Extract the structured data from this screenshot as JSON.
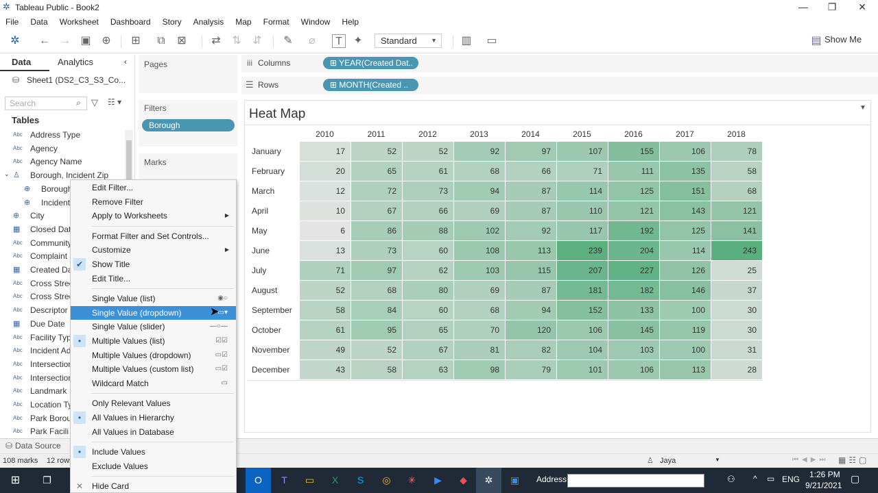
{
  "window": {
    "title": "Tableau Public - Book2",
    "minimize": "—",
    "restore": "❐",
    "close": "✕"
  },
  "menu": [
    "File",
    "Data",
    "Worksheet",
    "Dashboard",
    "Story",
    "Analysis",
    "Map",
    "Format",
    "Window",
    "Help"
  ],
  "toolbar": {
    "view_select": "Standard",
    "show_me": "Show Me"
  },
  "datapane": {
    "tab_data": "Data",
    "tab_analytics": "Analytics",
    "datasource": "Sheet1 (DS2_C3_S3_Co...",
    "search_placeholder": "Search",
    "tables_header": "Tables",
    "fields": [
      {
        "type": "Abc",
        "label": "Address Type"
      },
      {
        "type": "Abc",
        "label": "Agency"
      },
      {
        "type": "Abc",
        "label": "Agency Name"
      },
      {
        "type": "hier",
        "label": "Borough, Incident Zip"
      },
      {
        "type": "geo",
        "label": "Borough"
      },
      {
        "type": "geo",
        "label": "Incident"
      },
      {
        "type": "geo",
        "label": "City"
      },
      {
        "type": "date",
        "label": "Closed Dat"
      },
      {
        "type": "Abc",
        "label": "Community"
      },
      {
        "type": "Abc",
        "label": "Complaint"
      },
      {
        "type": "date",
        "label": "Created Da"
      },
      {
        "type": "Abc",
        "label": "Cross Stree"
      },
      {
        "type": "Abc",
        "label": "Cross Stree"
      },
      {
        "type": "Abc",
        "label": "Descriptor"
      },
      {
        "type": "date",
        "label": "Due Date"
      },
      {
        "type": "Abc",
        "label": "Facility Typ"
      },
      {
        "type": "Abc",
        "label": "Incident Ad"
      },
      {
        "type": "Abc",
        "label": "Intersection"
      },
      {
        "type": "Abc",
        "label": "Intersection"
      },
      {
        "type": "Abc",
        "label": "Landmark"
      },
      {
        "type": "Abc",
        "label": "Location Ty"
      },
      {
        "type": "Abc",
        "label": "Park Borou"
      },
      {
        "type": "Abc",
        "label": "Park Facili"
      }
    ]
  },
  "cards": {
    "pages": "Pages",
    "filters": "Filters",
    "filter_pill": "Borough",
    "marks": "Marks"
  },
  "shelves": {
    "columns_label": "Columns",
    "columns_pill": "YEAR(Created Dat..",
    "rows_label": "Rows",
    "rows_pill": "MONTH(Created .."
  },
  "view": {
    "title": "Heat Map"
  },
  "chart_data": {
    "type": "heatmap",
    "title": "Heat Map",
    "x": [
      "2010",
      "2011",
      "2012",
      "2013",
      "2014",
      "2015",
      "2016",
      "2017",
      "2018"
    ],
    "y": [
      "January",
      "February",
      "March",
      "April",
      "May",
      "June",
      "July",
      "August",
      "September",
      "October",
      "November",
      "December"
    ],
    "values": [
      [
        17,
        52,
        52,
        92,
        97,
        107,
        155,
        106,
        78
      ],
      [
        20,
        65,
        61,
        68,
        66,
        71,
        111,
        135,
        58
      ],
      [
        12,
        72,
        73,
        94,
        87,
        114,
        125,
        151,
        68
      ],
      [
        10,
        67,
        66,
        69,
        87,
        110,
        121,
        143,
        121
      ],
      [
        6,
        86,
        88,
        102,
        92,
        117,
        192,
        125,
        141
      ],
      [
        13,
        73,
        60,
        108,
        113,
        239,
        204,
        114,
        243
      ],
      [
        71,
        97,
        62,
        103,
        115,
        207,
        227,
        126,
        25
      ],
      [
        52,
        68,
        80,
        69,
        87,
        181,
        182,
        146,
        37
      ],
      [
        58,
        84,
        60,
        68,
        94,
        152,
        133,
        100,
        30
      ],
      [
        61,
        95,
        65,
        70,
        120,
        106,
        145,
        119,
        30
      ],
      [
        49,
        52,
        67,
        81,
        82,
        104,
        103,
        100,
        31
      ],
      [
        43,
        58,
        63,
        98,
        79,
        101,
        106,
        113,
        28
      ]
    ],
    "color_low": "#e4e4e4",
    "color_high": "#5aaf7f"
  },
  "context_menu": [
    {
      "label": "Edit Filter...",
      "check": "",
      "arrow": false,
      "widget": ""
    },
    {
      "label": "Remove Filter",
      "check": "",
      "arrow": false,
      "widget": ""
    },
    {
      "label": "Apply to Worksheets",
      "check": "",
      "arrow": true,
      "widget": ""
    },
    {
      "sep": true
    },
    {
      "label": "Format Filter and Set Controls...",
      "check": "",
      "arrow": false,
      "widget": ""
    },
    {
      "label": "Customize",
      "check": "",
      "arrow": true,
      "widget": ""
    },
    {
      "label": "Show Title",
      "check": "✔",
      "arrow": false,
      "widget": ""
    },
    {
      "label": "Edit Title...",
      "check": "",
      "arrow": false,
      "widget": ""
    },
    {
      "sep": true
    },
    {
      "label": "Single Value (list)",
      "check": "",
      "arrow": false,
      "widget": "◉○"
    },
    {
      "label": "Single Value (dropdown)",
      "check": "",
      "arrow": false,
      "widget": "▭▾",
      "highlight": true
    },
    {
      "label": "Single Value (slider)",
      "check": "",
      "arrow": false,
      "widget": "—○—"
    },
    {
      "label": "Multiple Values (list)",
      "check": "•",
      "arrow": false,
      "widget": "☑☑"
    },
    {
      "label": "Multiple Values (dropdown)",
      "check": "",
      "arrow": false,
      "widget": "▭☑"
    },
    {
      "label": "Multiple Values (custom list)",
      "check": "",
      "arrow": false,
      "widget": "▭☑"
    },
    {
      "label": "Wildcard Match",
      "check": "",
      "arrow": false,
      "widget": "▭"
    },
    {
      "sep": true
    },
    {
      "label": "Only Relevant Values",
      "check": "",
      "arrow": false,
      "widget": ""
    },
    {
      "label": "All Values in Hierarchy",
      "check": "•",
      "arrow": false,
      "widget": ""
    },
    {
      "label": "All Values in Database",
      "check": "",
      "arrow": false,
      "widget": ""
    },
    {
      "sep": true
    },
    {
      "label": "Include Values",
      "check": "•",
      "arrow": false,
      "widget": ""
    },
    {
      "label": "Exclude Values",
      "check": "",
      "arrow": false,
      "widget": ""
    },
    {
      "sep": true
    },
    {
      "label": "Hide Card",
      "check": "✕",
      "arrow": false,
      "widget": ""
    }
  ],
  "bottom": {
    "data_source_tab": "Data Source",
    "marks_count": "108 marks",
    "rows_count": "12 rows",
    "user": "Jaya"
  },
  "taskbar": {
    "address_label": "Address",
    "lang": "ENG",
    "time": "1:26 PM",
    "date": "9/21/2021"
  }
}
